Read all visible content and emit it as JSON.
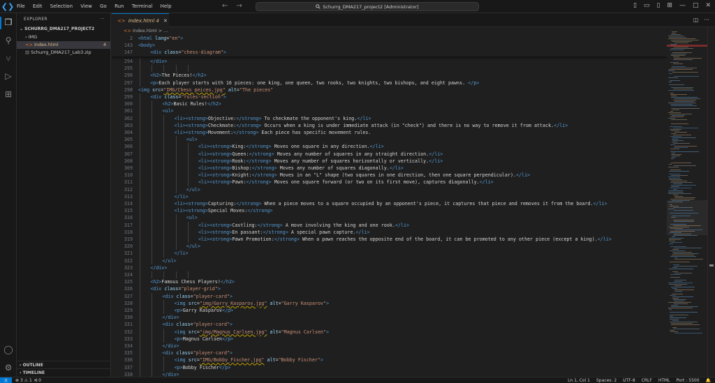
{
  "titlebar": {
    "menu": [
      "File",
      "Edit",
      "Selection",
      "View",
      "Go",
      "Run",
      "Terminal",
      "Help"
    ],
    "search": "Schurrg_DMA217_project2 [Administrator]"
  },
  "sidebar": {
    "title": "EXPLORER",
    "project": "SCHURRG_DMA217_PROJECT2",
    "items": [
      {
        "label": "IMG",
        "kind": "folder"
      },
      {
        "label": "index.html",
        "count": "4",
        "kind": "html"
      },
      {
        "label": "Schurrg_DMA217_Lab3.zip",
        "kind": "zip"
      }
    ],
    "outline": "OUTLINE",
    "timeline": "TIMELINE"
  },
  "tab": {
    "label": "index.html",
    "count": "4"
  },
  "breadcrumb": {
    "file": "index.html",
    "more": "..."
  },
  "editor": {
    "sticky": [
      {
        "n": "2",
        "ind": 0,
        "c": [
          [
            "tg",
            "<html "
          ],
          [
            "at",
            "lang"
          ],
          [
            "tx",
            "="
          ],
          [
            "vl",
            "\"en\""
          ],
          [
            "tg",
            ">"
          ]
        ]
      },
      {
        "n": "143",
        "ind": 0,
        "c": [
          [
            "tg",
            "<body>"
          ]
        ]
      },
      {
        "n": "147",
        "ind": 1,
        "c": [
          [
            "tg",
            "<div "
          ],
          [
            "at",
            "class"
          ],
          [
            "tx",
            "="
          ],
          [
            "vl",
            "\"chess-diagram\""
          ],
          [
            "tg",
            ">"
          ]
        ]
      }
    ],
    "lines": [
      {
        "n": "294",
        "ind": 1,
        "c": [
          [
            "tg",
            "</div>"
          ]
        ]
      },
      {
        "n": "295",
        "ind": 0,
        "c": []
      },
      {
        "n": "296",
        "ind": 1,
        "c": [
          [
            "tg",
            "<h2>"
          ],
          [
            "tx",
            "The Pieces!"
          ],
          [
            "tg",
            "</h2>"
          ]
        ]
      },
      {
        "n": "297",
        "ind": 1,
        "c": [
          [
            "tg",
            "<p>"
          ],
          [
            "tx",
            "Each player starts with 16 pieces: one king, one queen, two rooks, two knights, two bishops, and eight pawns. "
          ],
          [
            "tg",
            "</p>"
          ]
        ]
      },
      {
        "n": "298",
        "ind": 0,
        "c": [
          [
            "tg",
            "<img "
          ],
          [
            "at",
            "src"
          ],
          [
            "tx",
            "="
          ],
          [
            "vl",
            "\"IMG/Chess peices.jpg\""
          ],
          [
            "tx",
            " "
          ],
          [
            "at",
            "alt"
          ],
          [
            "tx",
            "="
          ],
          [
            "vl",
            "\"The pieces\""
          ]
        ]
      },
      {
        "n": "299",
        "ind": 1,
        "c": [
          [
            "tg",
            "<div "
          ],
          [
            "at",
            "class"
          ],
          [
            "tx",
            "="
          ],
          [
            "vl",
            "\"rules-section\""
          ],
          [
            "tg",
            ">"
          ]
        ]
      },
      {
        "n": "300",
        "ind": 2,
        "c": [
          [
            "tg",
            "<h2>"
          ],
          [
            "tx",
            "Basic Rules!"
          ],
          [
            "tg",
            "</h2>"
          ]
        ]
      },
      {
        "n": "301",
        "ind": 2,
        "c": [
          [
            "tg",
            "<ul>"
          ]
        ]
      },
      {
        "n": "302",
        "ind": 3,
        "c": [
          [
            "tg",
            "<li><strong>"
          ],
          [
            "tx",
            "Objective:"
          ],
          [
            "tg",
            "</strong>"
          ],
          [
            "tx",
            " To checkmate the opponent's king."
          ],
          [
            "tg",
            "</li>"
          ]
        ]
      },
      {
        "n": "303",
        "ind": 3,
        "c": [
          [
            "tg",
            "<li><strong>"
          ],
          [
            "tx",
            "Checkmate:"
          ],
          [
            "tg",
            "</strong>"
          ],
          [
            "tx",
            " Occurs when a king is under immediate attack (in \"check\") and there is no way to remove it from attack."
          ],
          [
            "tg",
            "</li>"
          ]
        ]
      },
      {
        "n": "304",
        "ind": 3,
        "c": [
          [
            "tg",
            "<li><strong>"
          ],
          [
            "tx",
            "Movement:"
          ],
          [
            "tg",
            "</strong>"
          ],
          [
            "tx",
            " Each piece has specific movement rules."
          ]
        ]
      },
      {
        "n": "305",
        "ind": 4,
        "c": [
          [
            "tg",
            "<ul>"
          ]
        ]
      },
      {
        "n": "306",
        "ind": 5,
        "c": [
          [
            "tg",
            "<li><strong>"
          ],
          [
            "tx",
            "King:"
          ],
          [
            "tg",
            "</strong>"
          ],
          [
            "tx",
            " Moves one square in any direction."
          ],
          [
            "tg",
            "</li>"
          ]
        ]
      },
      {
        "n": "307",
        "ind": 5,
        "c": [
          [
            "tg",
            "<li><strong>"
          ],
          [
            "tx",
            "Queen:"
          ],
          [
            "tg",
            "</strong>"
          ],
          [
            "tx",
            " Moves any number of squares in any straight direction."
          ],
          [
            "tg",
            "</li>"
          ]
        ]
      },
      {
        "n": "308",
        "ind": 5,
        "c": [
          [
            "tg",
            "<li><strong>"
          ],
          [
            "tx",
            "Rook:"
          ],
          [
            "tg",
            "</strong>"
          ],
          [
            "tx",
            " Moves any number of squares horizontally or vertically."
          ],
          [
            "tg",
            "</li>"
          ]
        ]
      },
      {
        "n": "309",
        "ind": 5,
        "c": [
          [
            "tg",
            "<li><strong>"
          ],
          [
            "tx",
            "Bishop:"
          ],
          [
            "tg",
            "</strong>"
          ],
          [
            "tx",
            " Moves any number of squares diagonally."
          ],
          [
            "tg",
            "</li>"
          ]
        ]
      },
      {
        "n": "310",
        "ind": 5,
        "c": [
          [
            "tg",
            "<li><strong>"
          ],
          [
            "tx",
            "Knight:"
          ],
          [
            "tg",
            "</strong>"
          ],
          [
            "tx",
            " Moves in an \"L\" shape (two squares in one direction, then one square perpendicular)."
          ],
          [
            "tg",
            "</li>"
          ]
        ]
      },
      {
        "n": "311",
        "ind": 5,
        "c": [
          [
            "tg",
            "<li><strong>"
          ],
          [
            "tx",
            "Pawn:"
          ],
          [
            "tg",
            "</strong>"
          ],
          [
            "tx",
            " Moves one square forward (or two on its first move), captures diagonally."
          ],
          [
            "tg",
            "</li>"
          ]
        ]
      },
      {
        "n": "312",
        "ind": 4,
        "c": [
          [
            "tg",
            "</ul>"
          ]
        ]
      },
      {
        "n": "313",
        "ind": 3,
        "c": [
          [
            "tg",
            "</li>"
          ]
        ]
      },
      {
        "n": "314",
        "ind": 3,
        "c": [
          [
            "tg",
            "<li><strong>"
          ],
          [
            "tx",
            "Capturing:"
          ],
          [
            "tg",
            "</strong>"
          ],
          [
            "tx",
            " When a piece moves to a square occupied by an opponent's piece, it captures that piece and removes it from the board."
          ],
          [
            "tg",
            "</li>"
          ]
        ]
      },
      {
        "n": "315",
        "ind": 3,
        "c": [
          [
            "tg",
            "<li><strong>"
          ],
          [
            "tx",
            "Special Moves:"
          ],
          [
            "tg",
            "</strong>"
          ]
        ]
      },
      {
        "n": "316",
        "ind": 4,
        "c": [
          [
            "tg",
            "<ul>"
          ]
        ]
      },
      {
        "n": "317",
        "ind": 5,
        "c": [
          [
            "tg",
            "<li><strong>"
          ],
          [
            "tx",
            "Castling:"
          ],
          [
            "tg",
            "</strong>"
          ],
          [
            "tx",
            " A move involving the king and one rook."
          ],
          [
            "tg",
            "</li>"
          ]
        ]
      },
      {
        "n": "318",
        "ind": 5,
        "c": [
          [
            "tg",
            "<li><strong>"
          ],
          [
            "tx",
            "En passant:"
          ],
          [
            "tg",
            "</strong>"
          ],
          [
            "tx",
            " A special pawn capture."
          ],
          [
            "tg",
            "</li>"
          ]
        ]
      },
      {
        "n": "319",
        "ind": 5,
        "c": [
          [
            "tg",
            "<li><strong>"
          ],
          [
            "tx",
            "Pawn Promotion:"
          ],
          [
            "tg",
            "</strong>"
          ],
          [
            "tx",
            " When a pawn reaches the opposite end of the board, it can be promoted to any other piece (except a king)."
          ],
          [
            "tg",
            "</li>"
          ]
        ]
      },
      {
        "n": "320",
        "ind": 4,
        "c": [
          [
            "tg",
            "</ul>"
          ]
        ]
      },
      {
        "n": "321",
        "ind": 3,
        "c": [
          [
            "tg",
            "</li>"
          ]
        ]
      },
      {
        "n": "322",
        "ind": 2,
        "c": [
          [
            "tg",
            "</ul>"
          ]
        ]
      },
      {
        "n": "323",
        "ind": 1,
        "c": [
          [
            "tg",
            "</div>"
          ]
        ]
      },
      {
        "n": "324",
        "ind": 0,
        "c": []
      },
      {
        "n": "325",
        "ind": 1,
        "c": [
          [
            "tg",
            "<h2>"
          ],
          [
            "tx",
            "Famous Chess Players!"
          ],
          [
            "tg",
            "</h2>"
          ]
        ]
      },
      {
        "n": "326",
        "ind": 1,
        "c": [
          [
            "tg",
            "<div "
          ],
          [
            "at",
            "class"
          ],
          [
            "tx",
            "="
          ],
          [
            "vl",
            "\"player-grid\""
          ],
          [
            "tg",
            ">"
          ]
        ]
      },
      {
        "n": "327",
        "ind": 2,
        "c": [
          [
            "tg",
            "<div "
          ],
          [
            "at",
            "class"
          ],
          [
            "tx",
            "="
          ],
          [
            "vl",
            "\"player-card\""
          ],
          [
            "tg",
            ">"
          ]
        ]
      },
      {
        "n": "328",
        "ind": 3,
        "c": [
          [
            "tg",
            "<img "
          ],
          [
            "at",
            "src"
          ],
          [
            "tx",
            "="
          ],
          [
            "vl",
            "\"img/Garry_Kasparov.jpg\""
          ],
          [
            "tx",
            " "
          ],
          [
            "at",
            "alt"
          ],
          [
            "tx",
            "="
          ],
          [
            "vl",
            "\"Garry Kasparov\""
          ],
          [
            "tg",
            ">"
          ]
        ]
      },
      {
        "n": "329",
        "ind": 3,
        "c": [
          [
            "tg",
            "<p>"
          ],
          [
            "tx",
            "Garry Kasparov"
          ],
          [
            "tg",
            "</p>"
          ]
        ]
      },
      {
        "n": "330",
        "ind": 2,
        "c": [
          [
            "tg",
            "</div>"
          ]
        ]
      },
      {
        "n": "331",
        "ind": 2,
        "c": [
          [
            "tg",
            "<div "
          ],
          [
            "at",
            "class"
          ],
          [
            "tx",
            "="
          ],
          [
            "vl",
            "\"player-card\""
          ],
          [
            "tg",
            ">"
          ]
        ]
      },
      {
        "n": "332",
        "ind": 3,
        "c": [
          [
            "tg",
            "<img "
          ],
          [
            "at",
            "src"
          ],
          [
            "tx",
            "="
          ],
          [
            "vl",
            "\"img/Magnus_Carlsen.jpg\""
          ],
          [
            "tx",
            " "
          ],
          [
            "at",
            "alt"
          ],
          [
            "tx",
            "="
          ],
          [
            "vl",
            "\"Magnus Carlsen\""
          ],
          [
            "tg",
            ">"
          ]
        ]
      },
      {
        "n": "333",
        "ind": 3,
        "c": [
          [
            "tg",
            "<p>"
          ],
          [
            "tx",
            "Magnus Carlsen"
          ],
          [
            "tg",
            "</p>"
          ]
        ]
      },
      {
        "n": "334",
        "ind": 2,
        "c": [
          [
            "tg",
            "</div>"
          ]
        ]
      },
      {
        "n": "335",
        "ind": 2,
        "c": [
          [
            "tg",
            "<div "
          ],
          [
            "at",
            "class"
          ],
          [
            "tx",
            "="
          ],
          [
            "vl",
            "\"player-card\""
          ],
          [
            "tg",
            ">"
          ]
        ]
      },
      {
        "n": "336",
        "ind": 3,
        "c": [
          [
            "tg",
            "<img "
          ],
          [
            "at",
            "src"
          ],
          [
            "tx",
            "="
          ],
          [
            "vl",
            "\"IMG/Bobby_Fischer.jpg\""
          ],
          [
            "tx",
            " "
          ],
          [
            "at",
            "alt"
          ],
          [
            "tx",
            "="
          ],
          [
            "vl",
            "\"Bobby Fischer\""
          ],
          [
            "tg",
            ">"
          ]
        ]
      },
      {
        "n": "337",
        "ind": 3,
        "c": [
          [
            "tg",
            "<p>"
          ],
          [
            "tx",
            "Bobby Fischer"
          ],
          [
            "tg",
            "</p>"
          ]
        ]
      },
      {
        "n": "338",
        "ind": 2,
        "c": [
          [
            "tg",
            "</div>"
          ]
        ]
      }
    ]
  },
  "status": {
    "errors": "3",
    "warnings": "1",
    "ports": "0",
    "position": "Ln 1, Col 1",
    "spaces": "Spaces: 2",
    "encoding": "UTF-8",
    "eol": "CRLF",
    "language": "HTML",
    "port": "Port : 5500"
  }
}
